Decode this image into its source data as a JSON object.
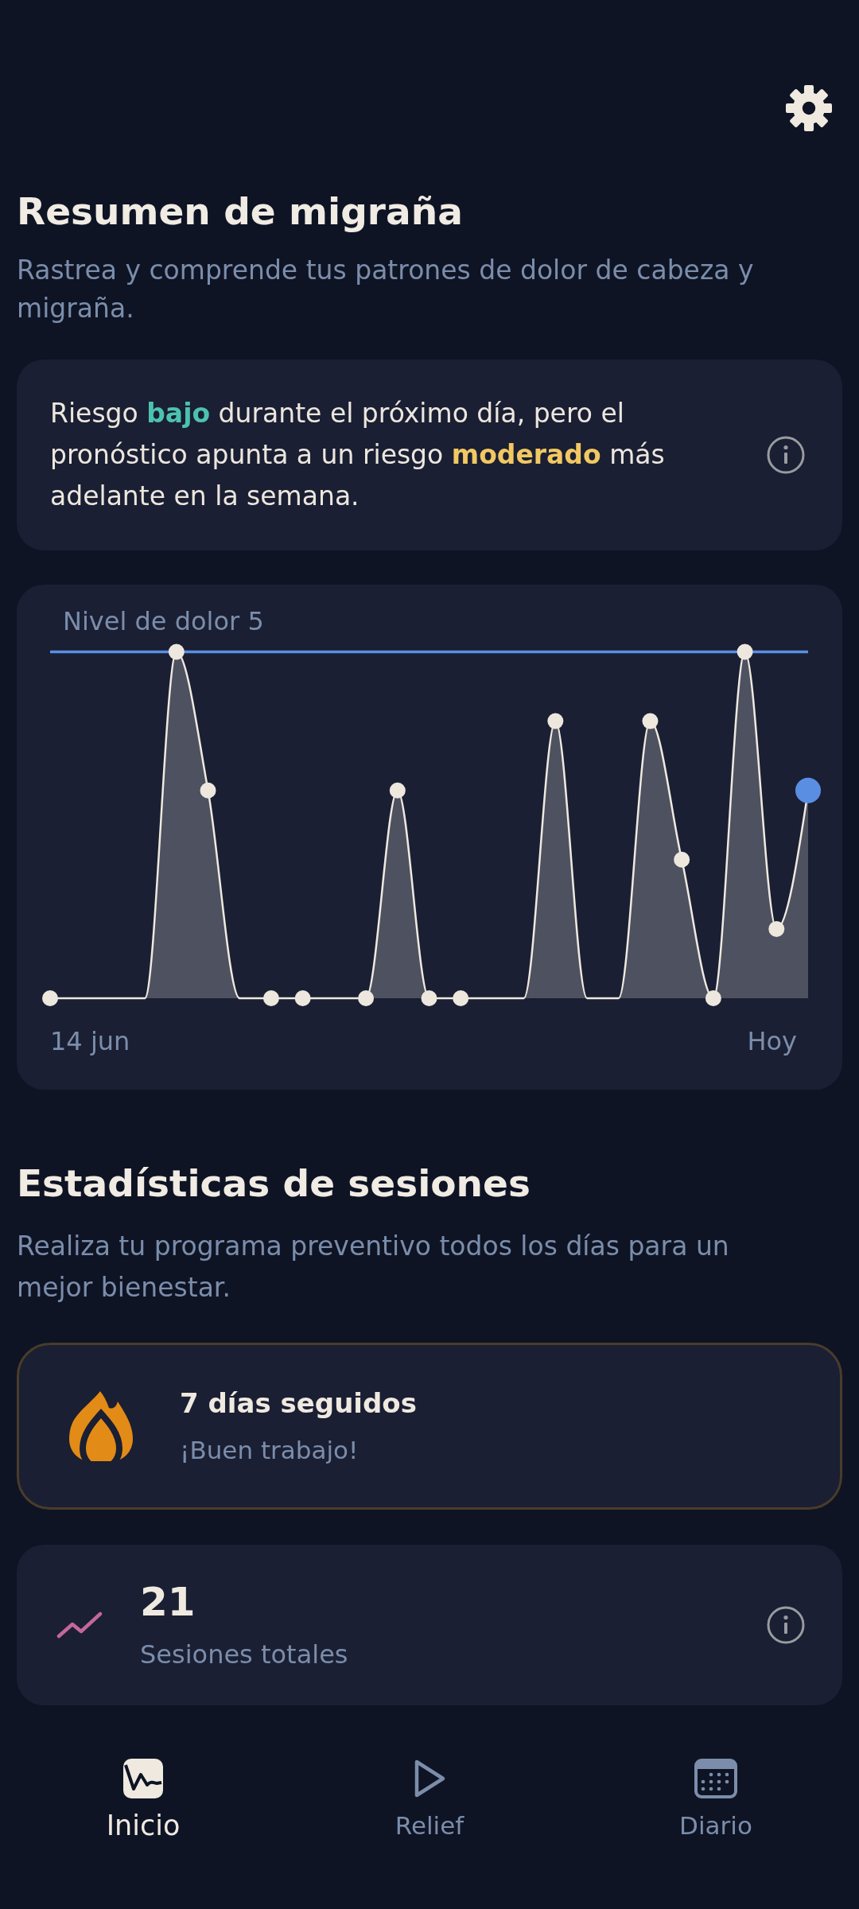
{
  "summary": {
    "title": "Resumen de migraña",
    "subtitle": "Rastrea y comprende tus patrones de dolor de cabeza y migraña."
  },
  "forecast": {
    "segments": [
      {
        "text": "Riesgo ",
        "kind": "text"
      },
      {
        "text": "bajo",
        "kind": "low"
      },
      {
        "text": " durante el próximo día, pero el pronóstico apunta a un riesgo ",
        "kind": "text"
      },
      {
        "text": "moderado",
        "kind": "moderate"
      },
      {
        "text": " más adelante en la semana.",
        "kind": "text"
      }
    ]
  },
  "chart": {
    "label": "Nivel de dolor 5",
    "start_label": "14 jun",
    "end_label": "Hoy"
  },
  "sessions": {
    "title": "Estadísticas de sesiones",
    "subtitle": "Realiza tu programa preventivo todos los días para un mejor bienestar.",
    "streak": {
      "title": "7 días seguidos",
      "subtitle": "¡Buen trabajo!"
    },
    "total": {
      "value": "21",
      "label": "Sesiones totales"
    }
  },
  "nav": [
    {
      "label": "Inicio",
      "kind": "home",
      "selected": true
    },
    {
      "label": "Relief",
      "kind": "play",
      "selected": false
    },
    {
      "label": "Diario",
      "kind": "calendar",
      "selected": false
    }
  ]
}
